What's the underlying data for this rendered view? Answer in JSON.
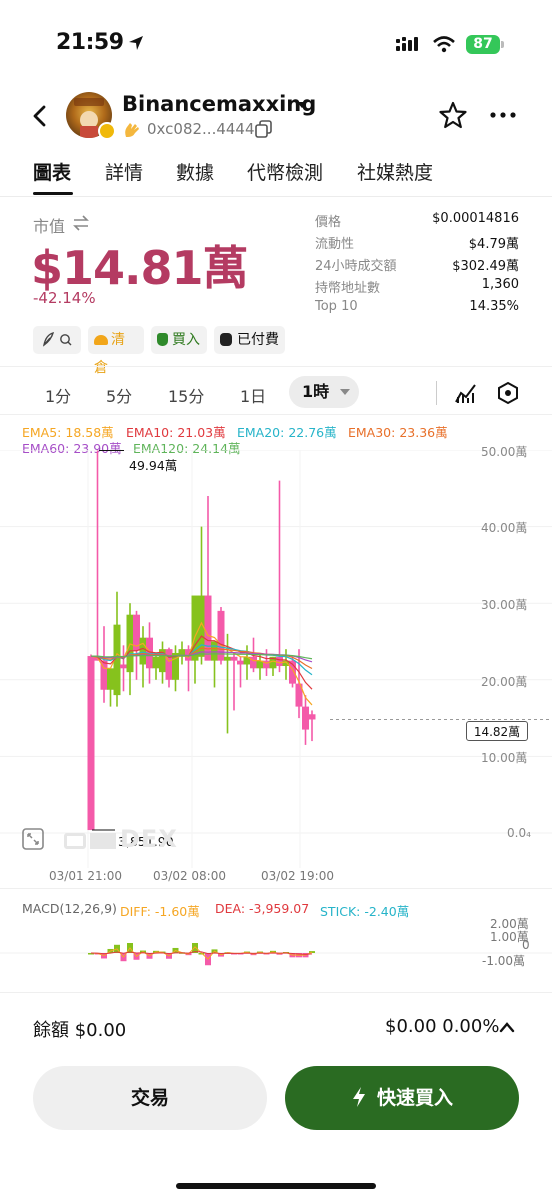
{
  "status_bar": {
    "time": "21:59",
    "battery": "87"
  },
  "header": {
    "token_name": "Binancemaxxing",
    "address": "0xc082...4444"
  },
  "tabs": [
    {
      "label": "圖表",
      "active": true
    },
    {
      "label": "詳情"
    },
    {
      "label": "數據"
    },
    {
      "label": "代幣檢測"
    },
    {
      "label": "社媒熱度"
    }
  ],
  "market": {
    "label": "市值",
    "value": "$14.81萬",
    "change": "-42.14%",
    "stats": [
      {
        "label": "價格",
        "value": "$0.00014816"
      },
      {
        "label": "流動性",
        "value": "$4.79萬"
      },
      {
        "label": "24小時成交額",
        "value": "$302.49萬"
      },
      {
        "label": "持幣地址數",
        "value": "1,360"
      },
      {
        "label": "Top 10",
        "value": "14.35%"
      }
    ]
  },
  "tags": {
    "liquidate": "清倉",
    "buy": "買入",
    "paid": "已付費"
  },
  "timeframes": [
    "1分",
    "5分",
    "15分",
    "1日"
  ],
  "timeframe_active": "1時",
  "ema": {
    "ema5": "EMA5: 18.58萬",
    "ema10": "EMA10: 21.03萬",
    "ema20": "EMA20: 22.76萬",
    "ema30": "EMA30: 23.36萬",
    "ema60": "EMA60: 23.90萬",
    "ema120": "EMA120: 24.14萬"
  },
  "chart_labels": {
    "high_marker": "49.94萬",
    "low_marker": "3,851.90",
    "current_price": "14.82萬",
    "watermark": "DEX",
    "y_ticks": [
      "50.00萬",
      "40.00萬",
      "30.00萬",
      "20.00萬",
      "10.00萬",
      "0.0₄"
    ],
    "x_ticks": [
      "03/01 21:00",
      "03/02 08:00",
      "03/02 19:00"
    ]
  },
  "macd": {
    "title": "MACD(12,26,9)",
    "diff": "DIFF: -1.60萬",
    "dea": "DEA: -3,959.07",
    "stick": "STICK: -2.40萬",
    "y_ticks": [
      "2.00萬",
      "1.00萬",
      "0",
      "-1.00萬"
    ]
  },
  "chart_data": {
    "type": "candlestick",
    "unit": "萬",
    "ylim": [
      0,
      50
    ],
    "x_ticks": [
      "03/01 21:00",
      "03/02 08:00",
      "03/02 19:00"
    ],
    "candles": [
      {
        "o": 23.1,
        "h": 23.3,
        "l": 0.385,
        "c": 0.385
      },
      {
        "o": 23.1,
        "h": 49.94,
        "l": 22.5,
        "c": 22.5
      },
      {
        "o": 22.5,
        "h": 27.0,
        "l": 17.0,
        "c": 18.7
      },
      {
        "o": 18.7,
        "h": 19.6,
        "l": 16.5,
        "c": 21.5
      },
      {
        "o": 18.0,
        "h": 31.5,
        "l": 16.5,
        "c": 27.2
      },
      {
        "o": 22.0,
        "h": 24.5,
        "l": 18.5,
        "c": 21.5
      },
      {
        "o": 21.0,
        "h": 30.0,
        "l": 18.0,
        "c": 28.5
      },
      {
        "o": 28.5,
        "h": 29.0,
        "l": 20.0,
        "c": 23.8
      },
      {
        "o": 22.0,
        "h": 27.0,
        "l": 19.0,
        "c": 25.5
      },
      {
        "o": 25.5,
        "h": 27.5,
        "l": 19.5,
        "c": 21.5
      },
      {
        "o": 21.5,
        "h": 23.5,
        "l": 20.0,
        "c": 23.0
      },
      {
        "o": 21.0,
        "h": 25.0,
        "l": 19.5,
        "c": 24.0
      },
      {
        "o": 24.0,
        "h": 24.2,
        "l": 19.0,
        "c": 20.0
      },
      {
        "o": 20.0,
        "h": 24.5,
        "l": 18.5,
        "c": 23.5
      },
      {
        "o": 23.0,
        "h": 25.0,
        "l": 22.0,
        "c": 24.0
      },
      {
        "o": 24.0,
        "h": 24.5,
        "l": 18.5,
        "c": 22.5
      },
      {
        "o": 22.5,
        "h": 30.0,
        "l": 19.5,
        "c": 31.0
      },
      {
        "o": 23.0,
        "h": 40.0,
        "l": 22.0,
        "c": 31.0
      },
      {
        "o": 31.0,
        "h": 44.0,
        "l": 24.0,
        "c": 22.5
      },
      {
        "o": 22.5,
        "h": 24.0,
        "l": 19.0,
        "c": 25.0
      },
      {
        "o": 29.0,
        "h": 29.5,
        "l": 22.0,
        "c": 22.5
      },
      {
        "o": 22.5,
        "h": 26.0,
        "l": 13.0,
        "c": 23.0
      },
      {
        "o": 23.0,
        "h": 23.5,
        "l": 16.0,
        "c": 22.5
      },
      {
        "o": 22.5,
        "h": 23.0,
        "l": 19.0,
        "c": 22.0
      },
      {
        "o": 22.0,
        "h": 24.5,
        "l": 20.0,
        "c": 23.0
      },
      {
        "o": 23.0,
        "h": 25.5,
        "l": 21.0,
        "c": 21.5
      },
      {
        "o": 21.5,
        "h": 23.5,
        "l": 20.0,
        "c": 22.5
      },
      {
        "o": 22.5,
        "h": 24.0,
        "l": 20.5,
        "c": 21.5
      },
      {
        "o": 21.5,
        "h": 23.0,
        "l": 20.5,
        "c": 23.0
      },
      {
        "o": 23.0,
        "h": 46.0,
        "l": 21.0,
        "c": 21.8
      },
      {
        "o": 21.8,
        "h": 24.0,
        "l": 20.0,
        "c": 22.5
      },
      {
        "o": 22.5,
        "h": 23.0,
        "l": 19.0,
        "c": 19.5
      },
      {
        "o": 19.5,
        "h": 24.0,
        "l": 15.0,
        "c": 16.5
      },
      {
        "o": 16.5,
        "h": 18.0,
        "l": 11.5,
        "c": 13.5
      },
      {
        "o": 15.5,
        "h": 16.0,
        "l": 12.0,
        "c": 14.82
      }
    ],
    "series_colors": {
      "up": "#86c21d",
      "down": "#f45aa9",
      "ema5": "#f5a623",
      "ema10": "#e0393e",
      "ema20": "#27b4c9",
      "ema30": "#e8702a",
      "ema60": "#a64ec7",
      "ema120": "#5fb45a"
    }
  },
  "footer": {
    "balance": "餘額 $0.00",
    "balance_right": "$0.00 0.00%",
    "trade_label": "交易",
    "quick_buy_label": "快速買入"
  }
}
